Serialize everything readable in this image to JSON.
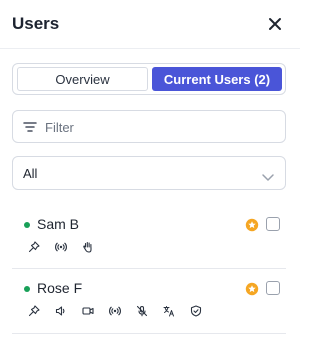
{
  "header": {
    "title": "Users",
    "close_icon": "close-icon"
  },
  "tabs": [
    {
      "label": "Overview",
      "active": false
    },
    {
      "label": "Current Users (2)",
      "active": true
    }
  ],
  "filter": {
    "placeholder": "Filter",
    "value": "",
    "icon": "filter-icon"
  },
  "select": {
    "value": "All",
    "icon": "chevron-down-icon"
  },
  "users": [
    {
      "name": "Sam B",
      "status": "online",
      "icons": [
        "pin-icon",
        "broadcast-icon",
        "raised-hand-icon"
      ]
    },
    {
      "name": "Rose F",
      "status": "online",
      "icons": [
        "pin-icon",
        "speaker-icon",
        "video-icon",
        "broadcast-icon",
        "muted-mic-icon",
        "translate-icon",
        "shield-icon"
      ]
    }
  ],
  "colors": {
    "accent": "#4a55d8",
    "online": "#18a058",
    "star": "#f5a623"
  }
}
